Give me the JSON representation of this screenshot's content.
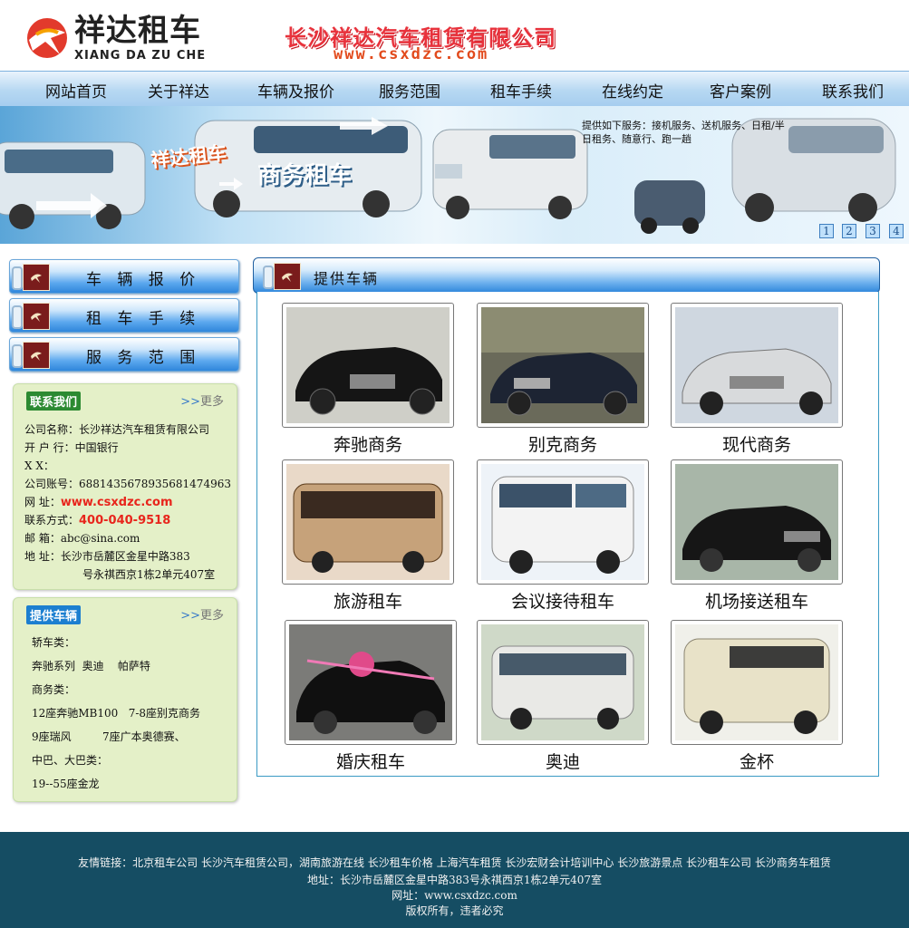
{
  "header": {
    "logo_cn": "祥达租车",
    "logo_en": "XIANG DA ZU CHE",
    "company_name": "长沙祥达汽车租赁有限公司",
    "company_url": "www.csxdzc.com"
  },
  "nav": [
    "网站首页",
    "关于祥达",
    "车辆及报价",
    "服务范围",
    "租车手续",
    "在线约定",
    "客户案例",
    "联系我们"
  ],
  "banner": {
    "brand": "祥达租车",
    "title": "商务租车",
    "desc": "提供如下服务：接机服务、送机服务、日租/半日租务、随意行、跑一趟",
    "pages": [
      "1",
      "2",
      "3",
      "4"
    ]
  },
  "side_menu": [
    "车 辆 报 价",
    "租 车 手 续",
    "服 务 范 围"
  ],
  "contact": {
    "title": "联系我们",
    "more": "更多",
    "rows": [
      {
        "k": "公司名称：",
        "v": "长沙祥达汽车租赁有限公司"
      },
      {
        "k": "开 户 行：",
        "v": "中国银行"
      },
      {
        "k": "X    X：",
        "v": ""
      },
      {
        "k": "公司账号：",
        "v": "6881435678935681474963"
      },
      {
        "k": "网    址：",
        "v": "www.csxdzc.com"
      },
      {
        "k": "联系方式：",
        "v": "400-040-9518"
      },
      {
        "k": "邮    箱：",
        "v": "abc@sina.com"
      },
      {
        "k": "地    址：",
        "v": "长沙市岳麓区金星中路383"
      }
    ],
    "addr2": "号永祺西京1栋2单元407室"
  },
  "provide": {
    "title": "提供车辆",
    "more": "更多",
    "lines": [
      "轿车类：",
      "奔驰系列  奥迪    帕萨特",
      "商务类：",
      "12座奔驰MB100   7-8座别克商务",
      "9座瑞风         7座广本奥德赛、",
      "中巴、大巴类：",
      "19--55座金龙"
    ]
  },
  "main": {
    "title": "提供车辆",
    "cars": [
      "奔驰商务",
      "别克商务",
      "现代商务",
      "旅游租车",
      "会议接待租车",
      "机场接送租车",
      "婚庆租车",
      "奥迪",
      "金杯"
    ]
  },
  "footer": {
    "links": "友情链接：北京租车公司  长沙汽车租赁公司，湖南旅游在线  长沙租车价格  上海汽车租赁  长沙宏财会计培训中心  长沙旅游景点  长沙租车公司  长沙商务车租赁",
    "address": "地址：长沙市岳麓区金星中路383号永祺西京1栋2单元407室",
    "website": "网址：www.csxdzc.com",
    "copyright": "版权所有，违者必究"
  }
}
